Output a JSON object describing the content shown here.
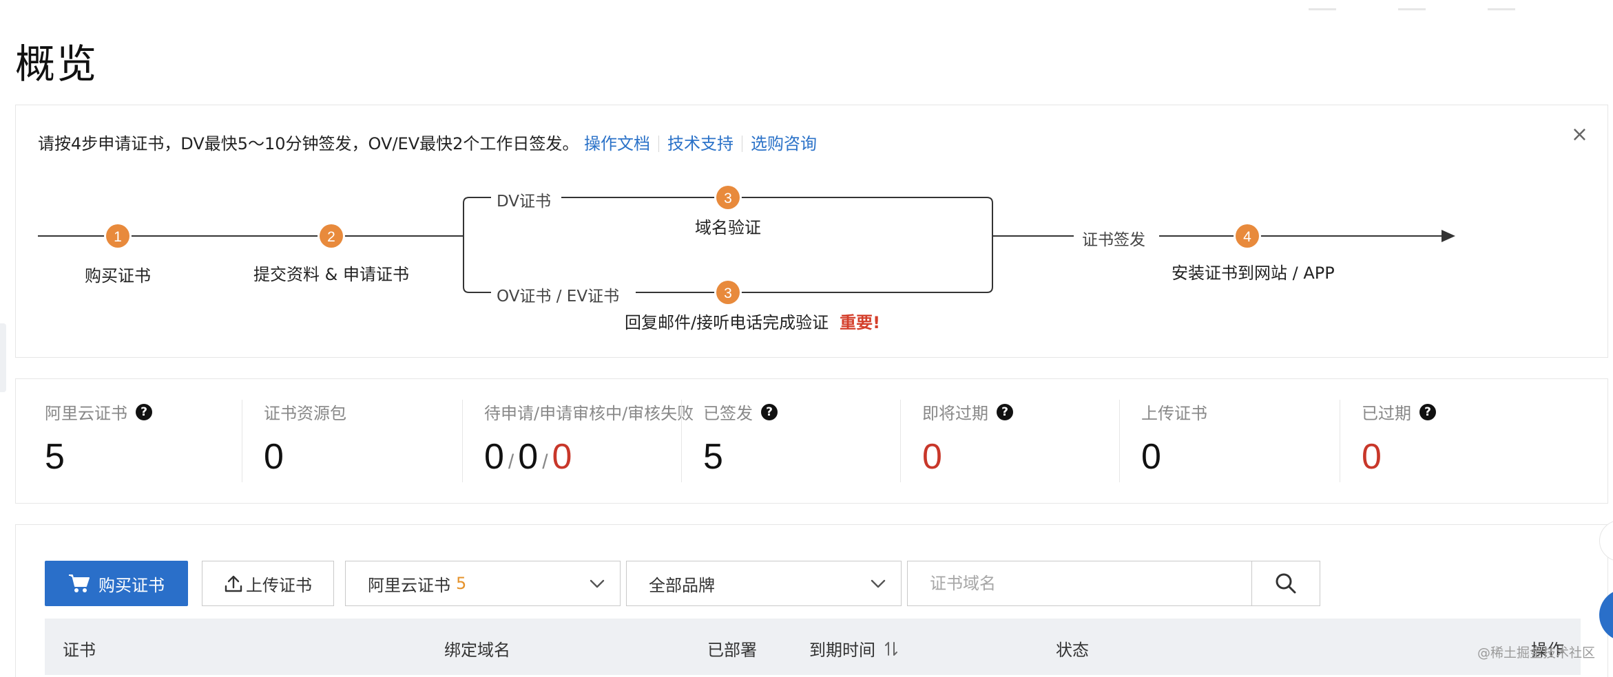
{
  "page": {
    "title": "概览"
  },
  "notice": {
    "text": "请按4步申请证书，DV最快5～10分钟签发，OV/EV最快2个工作日签发。",
    "links": [
      "操作文档",
      "技术支持",
      "选购咨询"
    ],
    "close_label": "×"
  },
  "flow": {
    "steps": [
      {
        "num": "1",
        "label": "购买证书"
      },
      {
        "num": "2",
        "label": "提交资料 & 申请证书"
      },
      {
        "num": "3",
        "branch": "DV证书",
        "label": "域名验证"
      },
      {
        "num": "3",
        "branch": "OV证书 / EV证书",
        "label": "回复邮件/接听电话完成验证",
        "important": "重要!"
      },
      {
        "num": "4",
        "pre_label": "证书签发",
        "label": "安装证书到网站 / APP"
      }
    ],
    "colors": {
      "step_circle": "#e88a3c",
      "line": "#333333"
    }
  },
  "stats": [
    {
      "label": "阿里云证书",
      "help": true,
      "value": "5",
      "red": false
    },
    {
      "label": "证书资源包",
      "help": false,
      "value": "0",
      "red": false
    },
    {
      "label": "待申请/申请审核中/审核失败",
      "help": false,
      "parts": [
        "0",
        "0",
        "0"
      ]
    },
    {
      "label": "已签发",
      "help": true,
      "value": "5",
      "red": false
    },
    {
      "label": "即将过期",
      "help": true,
      "value": "0",
      "red": true
    },
    {
      "label": "上传证书",
      "help": false,
      "value": "0",
      "red": false
    },
    {
      "label": "已过期",
      "help": true,
      "value": "0",
      "red": true
    }
  ],
  "toolbar": {
    "buy_label": "购买证书",
    "upload_label": "上传证书",
    "type_select": {
      "value": "阿里云证书",
      "count": "5"
    },
    "brand_select": {
      "value": "全部品牌"
    },
    "search_placeholder": "证书域名"
  },
  "table": {
    "columns": [
      "证书",
      "绑定域名",
      "已部署",
      "到期时间",
      "状态",
      "操作"
    ]
  },
  "watermark": "@稀土掘金技术社区",
  "colors": {
    "primary": "#2a6fc9",
    "danger": "#c8372a",
    "accent": "#e88a3c"
  }
}
